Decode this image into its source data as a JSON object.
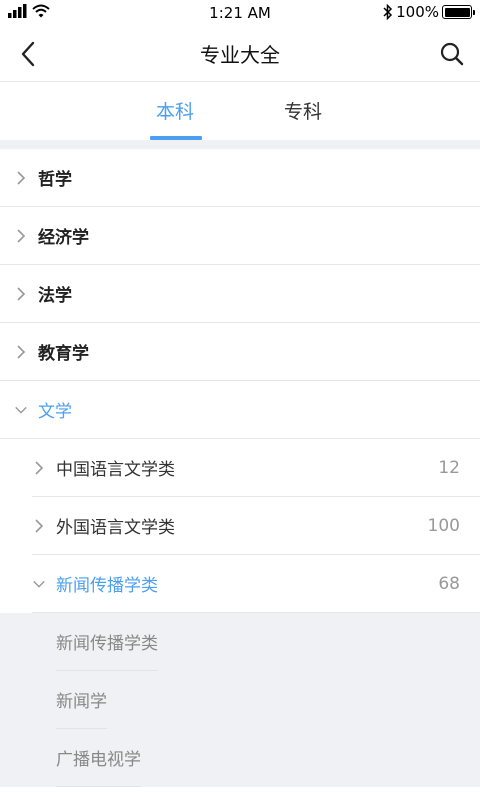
{
  "status_bar": {
    "time": "1:21 AM",
    "battery_text": "100%"
  },
  "nav": {
    "title": "专业大全"
  },
  "tabs": [
    {
      "label": "本科",
      "active": true
    },
    {
      "label": "专科",
      "active": false
    }
  ],
  "categories": [
    {
      "label": "哲学",
      "expanded": false
    },
    {
      "label": "经济学",
      "expanded": false
    },
    {
      "label": "法学",
      "expanded": false
    },
    {
      "label": "教育学",
      "expanded": false
    },
    {
      "label": "文学",
      "expanded": true
    }
  ],
  "subcategories": [
    {
      "label": "中国语言文学类",
      "count": "12",
      "expanded": false
    },
    {
      "label": "外国语言文学类",
      "count": "100",
      "expanded": false
    },
    {
      "label": "新闻传播学类",
      "count": "68",
      "expanded": true
    }
  ],
  "majors": [
    {
      "label": "新闻传播学类"
    },
    {
      "label": "新闻学"
    },
    {
      "label": "广播电视学"
    }
  ],
  "colors": {
    "accent": "#4a9ff0",
    "divider": "#e6e6e6",
    "panel_bg": "#f0f1f5"
  }
}
